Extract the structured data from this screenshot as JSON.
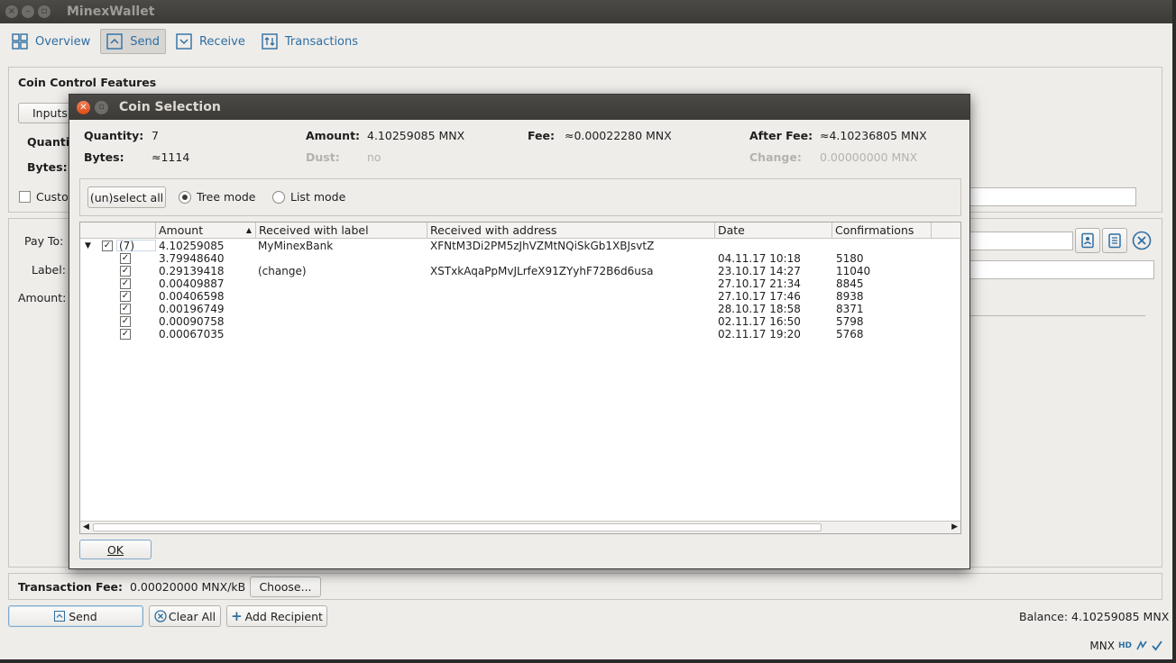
{
  "window": {
    "title": "MinexWallet"
  },
  "toolbar": [
    {
      "label": "Overview",
      "icon": "overview-icon"
    },
    {
      "label": "Send",
      "icon": "send-icon"
    },
    {
      "label": "Receive",
      "icon": "receive-icon"
    },
    {
      "label": "Transactions",
      "icon": "transactions-icon"
    }
  ],
  "coin_control": {
    "title": "Coin Control Features",
    "inputs_button": "Inputs...",
    "quantity_label": "Quantity:",
    "bytes_label": "Bytes:",
    "custom_label": "Custom change address"
  },
  "recipient": {
    "pay_to_label": "Pay To:",
    "label_label": "Label:",
    "amount_label": "Amount:"
  },
  "fee": {
    "label": "Transaction Fee:",
    "value": "0.00020000 MNX/kB",
    "choose_button": "Choose..."
  },
  "actions": {
    "send": "Send",
    "clear_all": "Clear All",
    "add_recipient": "Add Recipient",
    "balance": "Balance: 4.10259085 MNX"
  },
  "status": {
    "unit": "MNX",
    "hd": "HD"
  },
  "dialog": {
    "title": "Coin Selection",
    "quantity_label": "Quantity:",
    "quantity": "7",
    "amount_label": "Amount:",
    "amount": "4.10259085 MNX",
    "fee_label": "Fee:",
    "fee": "≈0.00022280 MNX",
    "after_fee_label": "After Fee:",
    "after_fee": "≈4.10236805 MNX",
    "bytes_label": "Bytes:",
    "bytes": "≈1114",
    "dust_label": "Dust:",
    "dust": "no",
    "change_label": "Change:",
    "change": "0.00000000 MNX",
    "unselect_all": "(un)select all",
    "tree_mode": "Tree mode",
    "list_mode": "List mode",
    "ok": "OK",
    "columns": [
      "Amount",
      "Received with label",
      "Received with address",
      "Date",
      "Confirmations"
    ],
    "group": {
      "count": "(7)",
      "amount": "4.10259085",
      "label": "MyMinexBank",
      "address": "XFNtM3Di2PM5zJhVZMtNQiSkGb1XBJsvtZ"
    },
    "rows": [
      {
        "amount": "3.79948640",
        "label": "",
        "address": "",
        "date": "04.11.17 10:18",
        "conf": "5180"
      },
      {
        "amount": "0.29139418",
        "label": "(change)",
        "address": "XSTxkAqaPpMvJLrfeX91ZYyhF72B6d6usa",
        "date": "23.10.17 14:27",
        "conf": "11040"
      },
      {
        "amount": "0.00409887",
        "label": "",
        "address": "",
        "date": "27.10.17 21:34",
        "conf": "8845"
      },
      {
        "amount": "0.00406598",
        "label": "",
        "address": "",
        "date": "27.10.17 17:46",
        "conf": "8938"
      },
      {
        "amount": "0.00196749",
        "label": "",
        "address": "",
        "date": "28.10.17 18:58",
        "conf": "8371"
      },
      {
        "amount": "0.00090758",
        "label": "",
        "address": "",
        "date": "02.11.17 16:50",
        "conf": "5798"
      },
      {
        "amount": "0.00067035",
        "label": "",
        "address": "",
        "date": "02.11.17 19:20",
        "conf": "5768"
      }
    ]
  }
}
